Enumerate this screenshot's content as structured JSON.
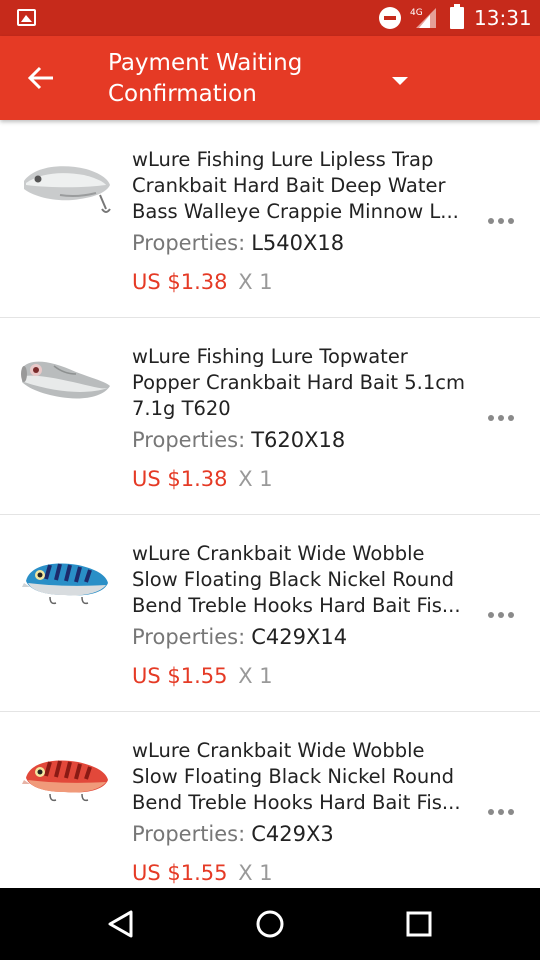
{
  "status_bar": {
    "network": "4G",
    "time": "13:31"
  },
  "app_bar": {
    "title_line1": "Payment Waiting",
    "title_line2": "Confirmation"
  },
  "orders": [
    {
      "title_lines": [
        "wLure Fishing Lure  Lipless Trap",
        "Crankbait Hard Bait  Deep Water",
        "Bass Walleye Crappie Minnow  L..."
      ],
      "properties_label": "Properties:",
      "properties_value": "L540X18",
      "price": "US $1.38",
      "quantity": "X 1"
    },
    {
      "title_lines": [
        "wLure Fishing Lure Topwater",
        "Popper Crankbait Hard Bait 5.1cm",
        "7.1g T620"
      ],
      "properties_label": "Properties:",
      "properties_value": "T620X18",
      "price": "US $1.38",
      "quantity": "X 1"
    },
    {
      "title_lines": [
        "wLure Crankbait Wide Wobble",
        "Slow Floating Black Nickel Round",
        "Bend Treble Hooks Hard Bait Fis..."
      ],
      "properties_label": "Properties:",
      "properties_value": "C429X14",
      "price": "US $1.55",
      "quantity": "X 1"
    },
    {
      "title_lines": [
        "wLure Crankbait Wide Wobble",
        "Slow Floating Black Nickel Round",
        "Bend Treble Hooks Hard Bait Fis..."
      ],
      "properties_label": "Properties:",
      "properties_value": "C429X3",
      "price": "US $1.55",
      "quantity": "X 1"
    }
  ],
  "colors": {
    "status_bar": "#c62a1b",
    "app_bar": "#e53a25",
    "price": "#e53a25"
  },
  "icons": {
    "back": "arrow-left-icon",
    "dropdown": "caret-down-icon",
    "more": "more-horizontal-icon",
    "nav_back": "triangle-back-icon",
    "nav_home": "circle-home-icon",
    "nav_recents": "square-recents-icon"
  }
}
